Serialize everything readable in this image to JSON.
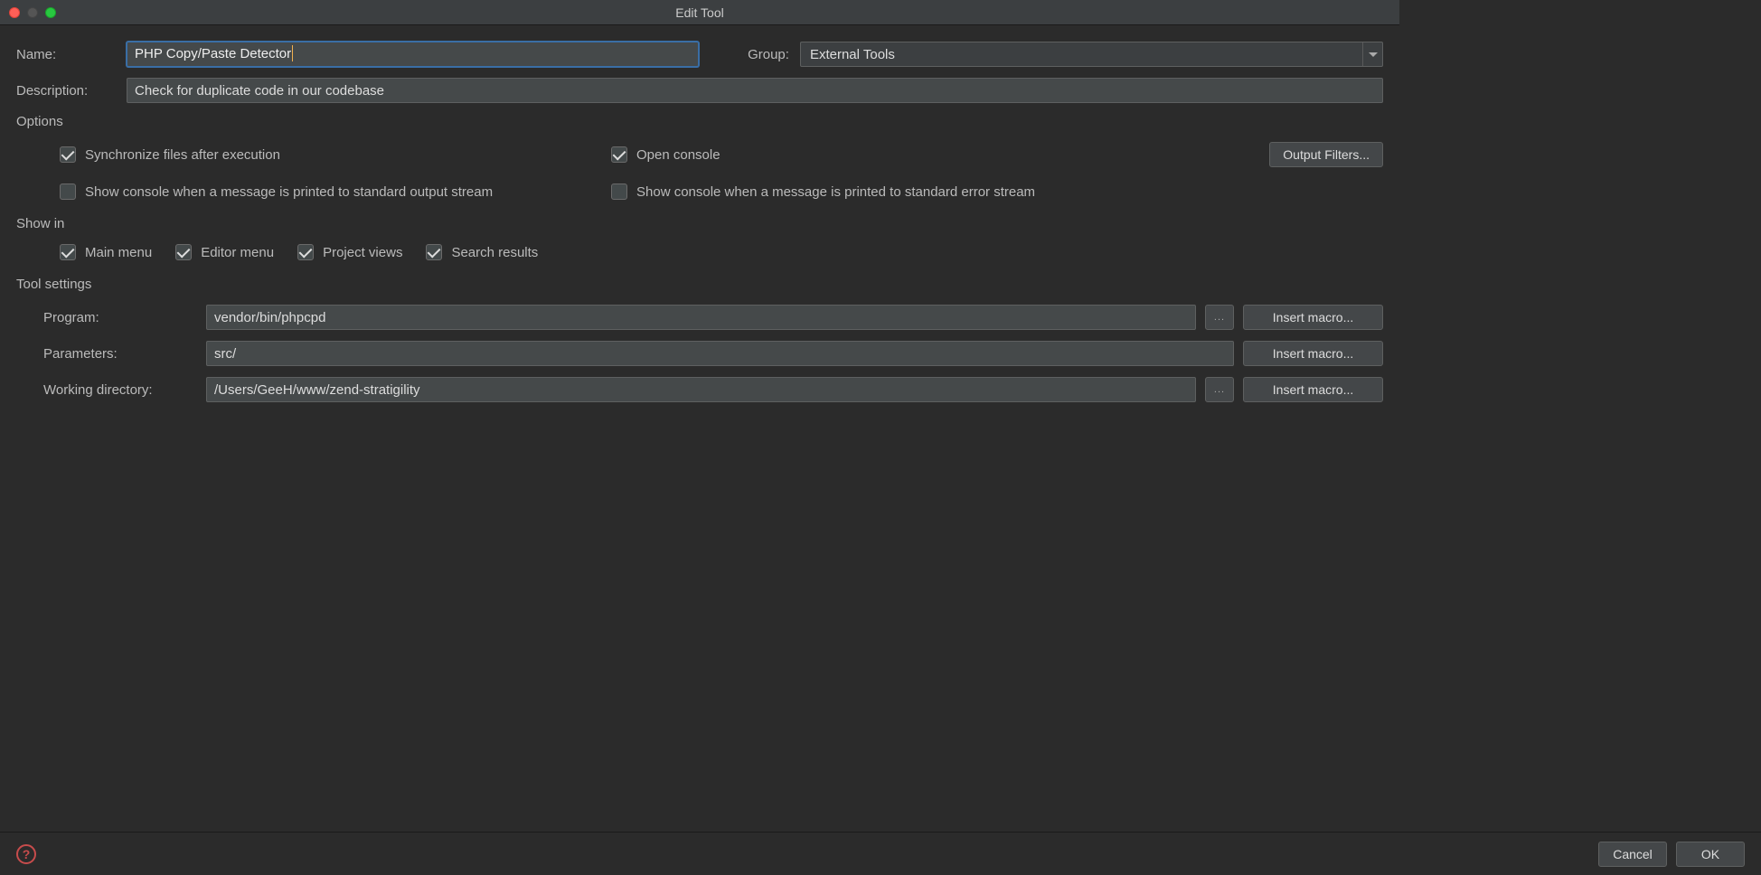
{
  "window": {
    "title": "Edit Tool"
  },
  "fields": {
    "name_label": "Name:",
    "name_value": "PHP Copy/Paste Detector",
    "group_label": "Group:",
    "group_value": "External Tools",
    "description_label": "Description:",
    "description_value": "Check for duplicate code in our codebase"
  },
  "sections": {
    "options_title": "Options",
    "showin_title": "Show in",
    "tool_settings_title": "Tool settings"
  },
  "options": {
    "sync_files": "Synchronize files after execution",
    "open_console": "Open console",
    "output_filters_btn": "Output Filters...",
    "show_stdout": "Show console when a message is printed to standard output stream",
    "show_stderr": "Show console when a message is printed to standard error stream"
  },
  "showin": {
    "main_menu": "Main menu",
    "editor_menu": "Editor menu",
    "project_views": "Project views",
    "search_results": "Search results"
  },
  "tool_settings": {
    "program_label": "Program:",
    "program_value": "vendor/bin/phpcpd",
    "parameters_label": "Parameters:",
    "parameters_value": "src/",
    "workdir_label": "Working directory:",
    "workdir_value": "/Users/GeeH/www/zend-stratigility",
    "browse_btn": "...",
    "insert_macro_btn": "Insert macro..."
  },
  "footer": {
    "cancel": "Cancel",
    "ok": "OK"
  }
}
